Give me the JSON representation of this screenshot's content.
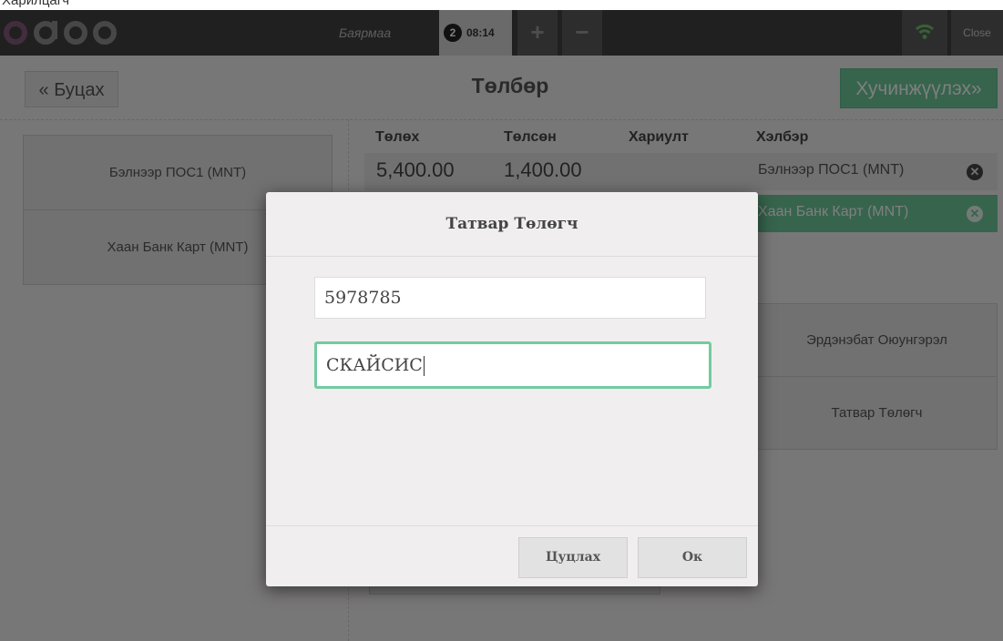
{
  "caption": "Харилцагч",
  "topbar": {
    "logo": "odoo",
    "cashier": "Баярмаа",
    "order_number": "2",
    "order_time": "08:14",
    "add_label": "+",
    "remove_label": "−",
    "close_label": "Close",
    "wifi_color": "#6ec26b"
  },
  "screen": {
    "back_label": "« Буцах",
    "title": "Төлбөр",
    "next_label": "Хучинжүүлэх»",
    "payment_methods": [
      "Бэлнээр ПОС1 (MNT)",
      "Хаан Банк Карт (MNT)"
    ],
    "columns": {
      "due": "Төлөх",
      "tendered": "Төлсөн",
      "change": "Хариулт",
      "method": "Хэлбэр"
    },
    "lines": [
      {
        "due": "5,400.00",
        "tendered": "1,400.00",
        "method": "Бэлнээр ПОС1 (MNT)"
      },
      {
        "method": "Хаан Банк Карт (MNT)"
      }
    ],
    "side_buttons": [
      "Эрдэнэбат Оюунгэрэл",
      "Татвар Төлөгч"
    ]
  },
  "modal": {
    "title": "Татвар Төлөгч",
    "field1_value": "5978785",
    "field2_value": "СКАЙСИС",
    "cancel_label": "Цуцлах",
    "ok_label": "Ок"
  },
  "colors": {
    "accent": "#6ec89b",
    "topbar": "#414141",
    "logo": "#875a7b"
  }
}
